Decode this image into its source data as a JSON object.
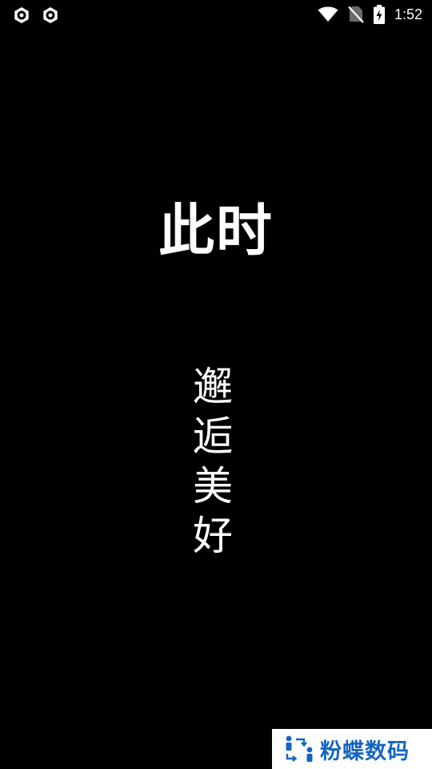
{
  "status_bar": {
    "time": "1:52",
    "left_icons": [
      "app-notification-icon",
      "app-notification-icon"
    ],
    "right_icons": [
      "wifi-icon",
      "no-sim-icon",
      "battery-charging-icon"
    ]
  },
  "content": {
    "headline": "此时",
    "vertical_chars": [
      "邂",
      "逅",
      "美",
      "好"
    ]
  },
  "watermark": {
    "text": "粉蝶数码",
    "color": "#1565c0"
  }
}
